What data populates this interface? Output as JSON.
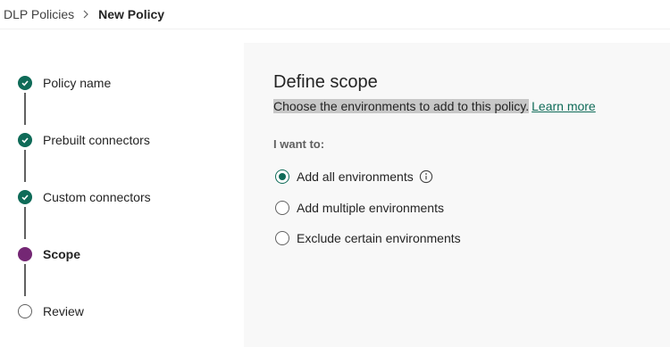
{
  "breadcrumb": {
    "parent": "DLP Policies",
    "current": "New Policy",
    "separator_icon": "chevron-right-icon"
  },
  "steps": [
    {
      "label": "Policy name",
      "state": "complete"
    },
    {
      "label": "Prebuilt connectors",
      "state": "complete"
    },
    {
      "label": "Custom connectors",
      "state": "complete"
    },
    {
      "label": "Scope",
      "state": "current"
    },
    {
      "label": "Review",
      "state": "upcoming"
    }
  ],
  "main": {
    "title": "Define scope",
    "description": "Choose the environments to add to this policy.",
    "learn_more": "Learn more",
    "prompt": "I want to:",
    "options": [
      {
        "label": "Add all environments",
        "selected": true,
        "has_info_icon": true
      },
      {
        "label": "Add multiple environments",
        "selected": false
      },
      {
        "label": "Exclude certain environments",
        "selected": false
      }
    ]
  },
  "colors": {
    "accent_green": "#0f6b58",
    "current_step_purple": "#742774",
    "main_background": "#f8f8f8",
    "description_highlight": "#c8c8c8"
  }
}
